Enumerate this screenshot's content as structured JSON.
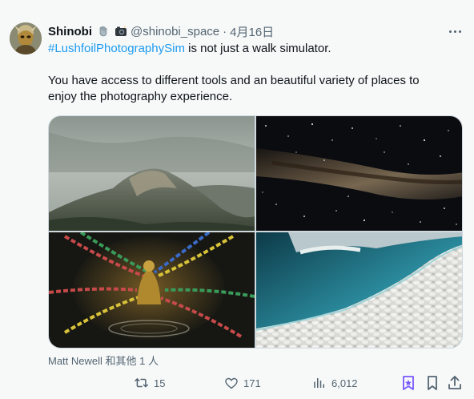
{
  "author": {
    "name": "Shinobi",
    "handle": "@shinobi_space",
    "separator": "·",
    "date": "4月16日",
    "emoji": [
      "palm-raised-emoji",
      "camera-flash-emoji"
    ]
  },
  "tweet": {
    "hashtag": "#LushfoilPhotographySim",
    "line1_rest": " is not just a walk simulator.",
    "line2": "You have access to different tools and an beautiful variety of places to",
    "line3": "enjoy the photography experience."
  },
  "media": {
    "images": [
      "misty-mountain-ridge-photo",
      "milky-way-night-sky-photo",
      "prayer-flags-buddha-statue-photo",
      "turquoise-water-white-stones-photo"
    ]
  },
  "tagged_text": "Matt Newell 和其他 1 人",
  "actions": {
    "retweets": "15",
    "likes": "171",
    "views": "6,012"
  },
  "colors": {
    "accent": "#1d9bf0",
    "muted": "#536471",
    "premium_icon": "#7856ff"
  }
}
